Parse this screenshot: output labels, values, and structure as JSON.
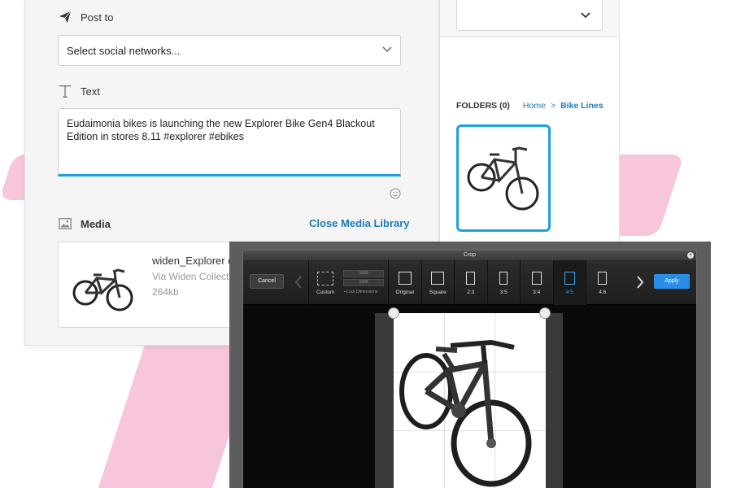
{
  "composer": {
    "post_to": {
      "label": "Post to",
      "icon": "paper-plane-icon"
    },
    "social_select": {
      "value": "Select social networks..."
    },
    "text": {
      "label": "Text",
      "icon": "text-t-icon",
      "value": "Eudaimonia bikes is launching the new Explorer Bike Gen4 Blackout Edition in stores 8.11 #explorer #ebikes"
    },
    "media": {
      "label": "Media",
      "icon": "image-icon",
      "close_link": "Close Media Library",
      "item": {
        "name": "widen_Explorer d",
        "via": "Via Widen Collect",
        "size": "264kb"
      }
    }
  },
  "library": {
    "folders_label": "FOLDERS (0)",
    "breadcrumb": {
      "home": "Home",
      "separator": ">",
      "current": "Bike Lines"
    }
  },
  "crop": {
    "title": "Crop",
    "cancel_label": "Cancel",
    "apply_label": "Apply",
    "custom": {
      "label": "Custom",
      "width": "1000",
      "height": "1000",
      "lock_label": "Lock Dimensions"
    },
    "ratios": [
      {
        "label": "Original",
        "w": 16,
        "h": 16,
        "selected": false
      },
      {
        "label": "Square",
        "w": 16,
        "h": 16,
        "selected": false
      },
      {
        "label": "2:3",
        "w": 11,
        "h": 16,
        "selected": false
      },
      {
        "label": "3:5",
        "w": 10,
        "h": 16,
        "selected": false
      },
      {
        "label": "3:4",
        "w": 12,
        "h": 16,
        "selected": false
      },
      {
        "label": "4:5",
        "w": 13,
        "h": 16,
        "selected": true
      },
      {
        "label": "4:6",
        "w": 11,
        "h": 16,
        "selected": false
      }
    ]
  },
  "colors": {
    "accent": "#1ea0e0",
    "link": "#1d7bbf",
    "apply": "#2a8ee8",
    "pink": "#f7c6da"
  }
}
